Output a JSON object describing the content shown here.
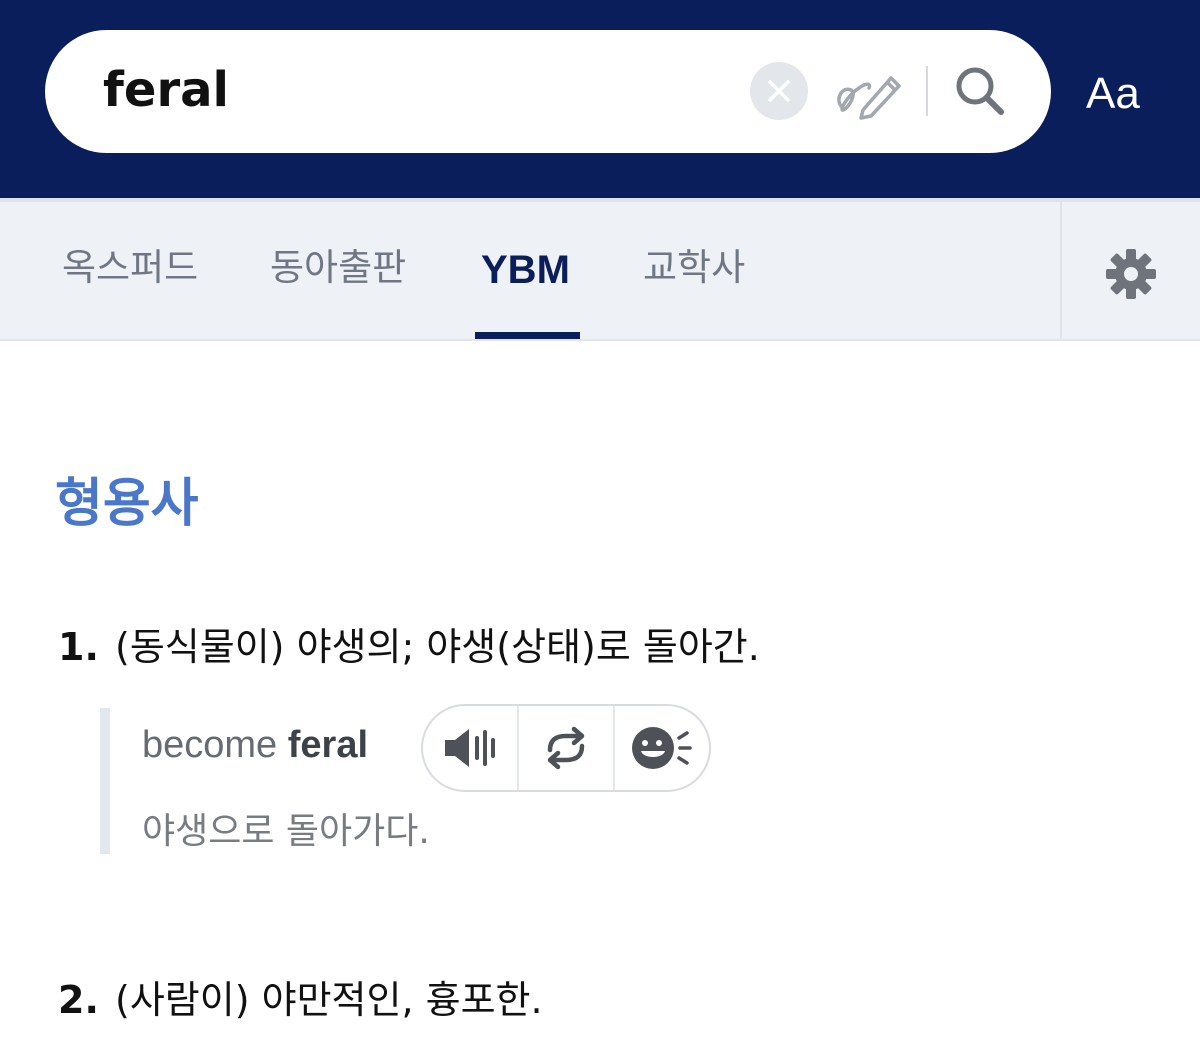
{
  "search": {
    "query": "feral",
    "font_button_label": "Aa"
  },
  "tabs": [
    {
      "label": "옥스퍼드",
      "active": false
    },
    {
      "label": "동아출판",
      "active": false
    },
    {
      "label": "YBM",
      "active": true
    },
    {
      "label": "교학사",
      "active": false
    }
  ],
  "entry": {
    "part_of_speech": "형용사",
    "definitions": [
      {
        "number": "1.",
        "text": "(동식물이) 야생의; 야생(상태)로 돌아간.",
        "example": {
          "prefix": "become ",
          "highlight": "feral",
          "translation": "야생으로 돌아가다."
        }
      },
      {
        "number": "2.",
        "text": "(사람이) 야만적인, 흉포한."
      }
    ]
  },
  "icons": {
    "clear": "close-circle-icon",
    "handwrite": "handwriting-pen-icon",
    "search": "search-icon",
    "settings": "gear-icon",
    "audio": "speaker-icon",
    "repeat": "repeat-icon",
    "speak": "speaking-face-icon"
  },
  "colors": {
    "header_bg": "#0a1e5b",
    "accent_blue": "#4a77c9",
    "tab_bg": "#eef1f5"
  }
}
